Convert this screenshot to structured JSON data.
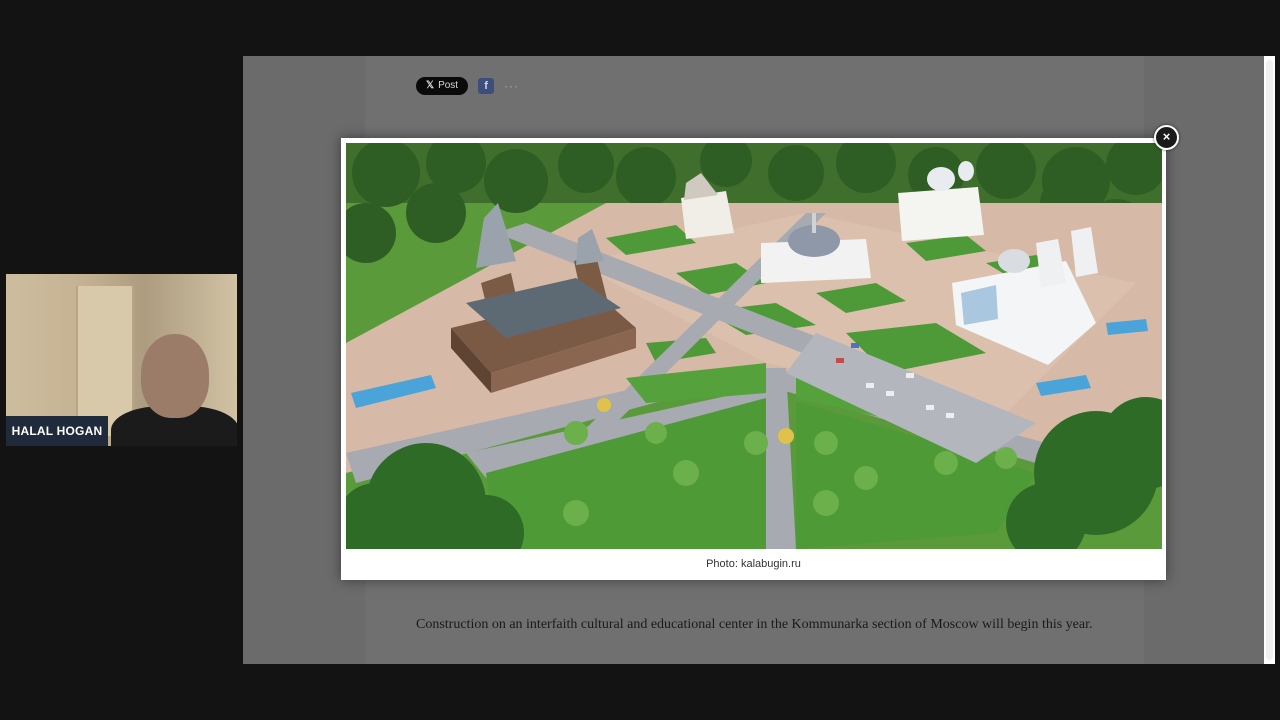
{
  "webcam": {
    "participant_name": "HALAL HOGAN"
  },
  "article": {
    "share": {
      "x_post_label": "Post",
      "x_icon": "x-logo-icon",
      "facebook_icon": "facebook-icon",
      "more_icon": "more-dots-icon",
      "more_label": "···"
    },
    "paragraph": "Construction on an interfaith cultural and educational center in the Kommunarka section of Moscow will begin this year."
  },
  "lightbox": {
    "caption": "Photo: kalabugin.ru",
    "close_icon": "close-icon",
    "close_glyph": "×"
  },
  "colors": {
    "backdrop": "#131313",
    "dimmed_page": "#6b6b6b",
    "grass": "#4f8b35",
    "plaza": "#d9b8a8",
    "road": "#a7aab1"
  }
}
